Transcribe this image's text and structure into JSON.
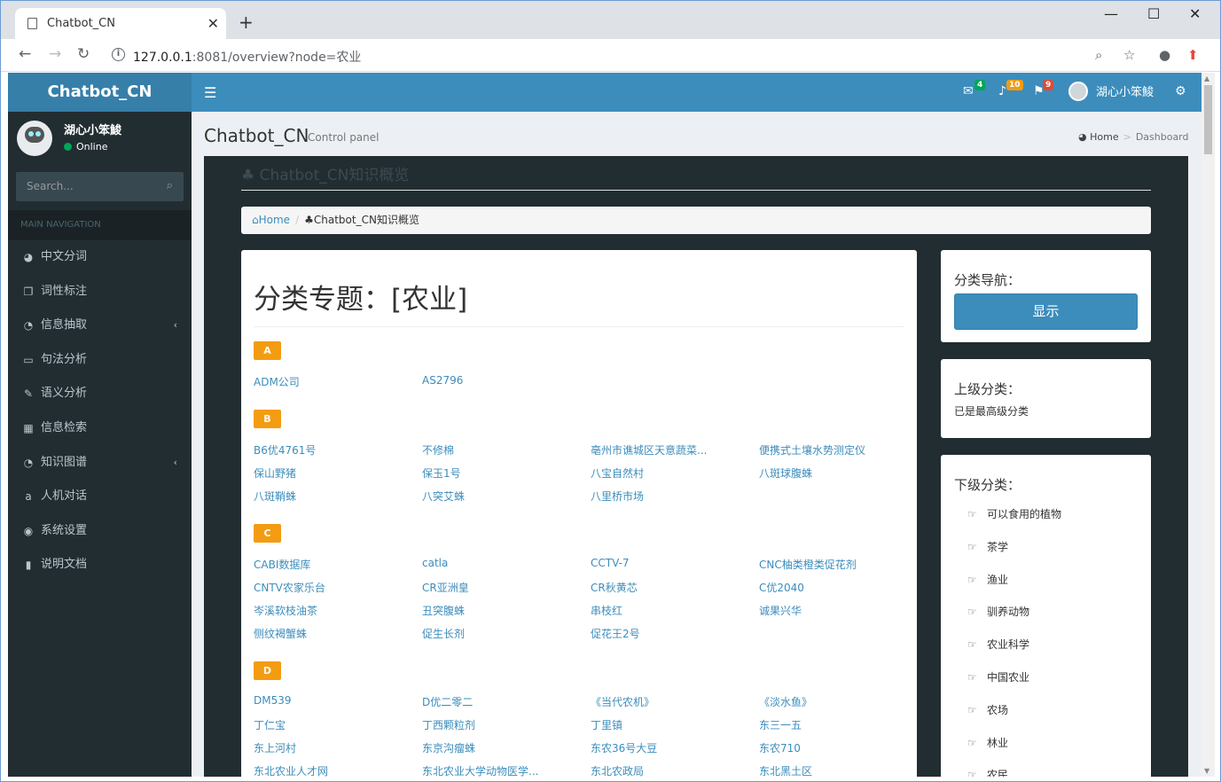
{
  "browser": {
    "tab_title": "Chatbot_CN",
    "url_host": "127.0.0.1",
    "url_rest": ":8081/overview?node=农业"
  },
  "header": {
    "logo": "Chatbot_CN",
    "badges": {
      "mail": "4",
      "bell": "10",
      "flag": "9"
    },
    "user": "湖心小笨鮻"
  },
  "sidebar": {
    "user_name": "湖心小笨鮻",
    "status": "Online",
    "search_placeholder": "Search...",
    "section": "MAIN NAVIGATION",
    "items": [
      {
        "label": "中文分词",
        "icon": "dashboard-icon"
      },
      {
        "label": "词性标注",
        "icon": "files-icon"
      },
      {
        "label": "信息抽取",
        "icon": "pie-chart-icon"
      },
      {
        "label": "句法分析",
        "icon": "laptop-icon"
      },
      {
        "label": "语义分析",
        "icon": "edit-icon"
      },
      {
        "label": "信息检索",
        "icon": "table-icon"
      },
      {
        "label": "知识图谱",
        "icon": "pie-chart-icon"
      },
      {
        "label": "人机对话",
        "icon": "chat-icon"
      },
      {
        "label": "系统设置",
        "icon": "compass-icon"
      },
      {
        "label": "说明文档",
        "icon": "book-icon"
      }
    ]
  },
  "content_header": {
    "title": "Chatbot_CN",
    "subtitle": "Control panel",
    "crumb_home": "Home",
    "crumb_active": "Dashboard"
  },
  "overview": {
    "heading": "Chatbot_CN知识概览",
    "bc_home": "Home",
    "bc_current": "Chatbot_CN知识概览"
  },
  "topic": {
    "heading": "分类专题：[农业]",
    "groups": [
      {
        "letter": "A",
        "links": [
          "ADM公司",
          "AS2796"
        ]
      },
      {
        "letter": "B",
        "links": [
          "B6优4761号",
          "不修棉",
          "亳州市谯城区天意蔬菜...",
          "便携式土壤水势测定仪",
          "保山野猪",
          "保玉1号",
          "八宝自然村",
          "八斑球腹蛛",
          "八斑鞘蛛",
          "八突艾蛛",
          "八里桥市场"
        ]
      },
      {
        "letter": "C",
        "links": [
          "CABI数据库",
          "catla",
          "CCTV-7",
          "CNC柚类橙类促花剂",
          "CNTV农家乐台",
          "CR亚洲皇",
          "CR秋黄芯",
          "C优2040",
          "岑溪软枝油茶",
          "丑突腹蛛",
          "串枝红",
          "诚果兴华",
          "侧纹褐蟹蛛",
          "促生长剂",
          "促花王2号"
        ]
      },
      {
        "letter": "D",
        "links": [
          "DM539",
          "D优二零二",
          "《当代农机》",
          "《淡水鱼》",
          "丁仁宝",
          "丁西颗粒剂",
          "丁里镇",
          "东三一五",
          "东上河村",
          "东京沟瘤蛛",
          "东农36号大豆",
          "东农710",
          "东北农业人才网",
          "东北农业大学动物医学...",
          "东北农政局",
          "东北黑土区"
        ]
      }
    ]
  },
  "right": {
    "nav_heading": "分类导航：",
    "show_button": "显示",
    "parent_heading": "上级分类：",
    "parent_text": "已是最高级分类",
    "children_heading": "下级分类：",
    "children": [
      "可以食用的植物",
      "茶学",
      "渔业",
      "驯养动物",
      "农业科学",
      "中国农业",
      "农场",
      "林业",
      "农民"
    ]
  }
}
